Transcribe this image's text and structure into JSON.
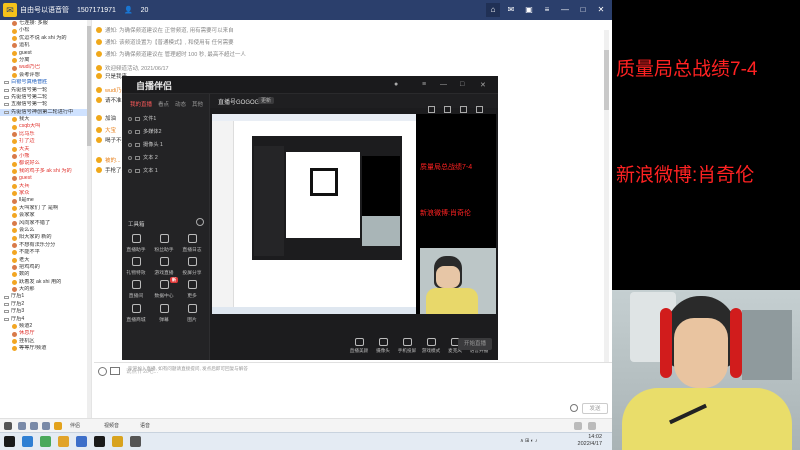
{
  "app": {
    "title": "自由号以语音管",
    "id": "1507171971",
    "count": "20",
    "window_controls": [
      "home",
      "mail",
      "gift",
      "settings",
      "minimize",
      "maximize",
      "close"
    ]
  },
  "sidebar": {
    "items": [
      {
        "label": "七连接: 多服",
        "type": "user"
      },
      {
        "label": "小松",
        "type": "user"
      },
      {
        "label": "优逗不说 ak shi 为的",
        "type": "user"
      },
      {
        "label": "运机",
        "type": "user"
      },
      {
        "label": "guest",
        "type": "user"
      },
      {
        "label": "分离",
        "type": "user"
      },
      {
        "label": "wudi乃巴",
        "type": "red"
      },
      {
        "label": "会考评想",
        "type": "user"
      },
      {
        "label": "白银号真绝普胜",
        "type": "hdr"
      },
      {
        "label": "先驱信号第一轮",
        "type": "channel"
      },
      {
        "label": "先驱信号第二轮",
        "type": "channel"
      },
      {
        "label": "五服信号第一轮",
        "type": "channel"
      },
      {
        "label": "先驱信号神创第二轮进行中",
        "type": "selected"
      },
      {
        "label": "我大",
        "type": "user"
      },
      {
        "label": "csqb大叫",
        "type": "red"
      },
      {
        "label": "比马乐",
        "type": "red"
      },
      {
        "label": "打了边",
        "type": "red"
      },
      {
        "label": "大夫",
        "type": "red"
      },
      {
        "label": "小熊",
        "type": "red"
      },
      {
        "label": "都说好么",
        "type": "red"
      },
      {
        "label": "我的鸡子多 ak shi 为的",
        "type": "red"
      },
      {
        "label": "guest",
        "type": "red"
      },
      {
        "label": "大兵",
        "type": "red"
      },
      {
        "label": "家众",
        "type": "red"
      },
      {
        "label": "ll是me",
        "type": "user"
      },
      {
        "label": "大叫家们 了 是啊",
        "type": "user"
      },
      {
        "label": "会家家",
        "type": "user"
      },
      {
        "label": "风向家不错了",
        "type": "user"
      },
      {
        "label": "会么么",
        "type": "user"
      },
      {
        "label": "阳大家的 新的",
        "type": "user"
      },
      {
        "label": "不想有法乐分分",
        "type": "user"
      },
      {
        "label": "不能不平",
        "type": "user"
      },
      {
        "label": "老大",
        "type": "user"
      },
      {
        "label": "把鸡鸡的",
        "type": "user"
      },
      {
        "label": "数的",
        "type": "user"
      },
      {
        "label": "跃着发 ak shi 用的",
        "type": "user"
      },
      {
        "label": "大的那",
        "type": "user"
      },
      {
        "label": "厅后1",
        "type": "room"
      },
      {
        "label": "厅后2",
        "type": "room"
      },
      {
        "label": "厅后3",
        "type": "room"
      },
      {
        "label": "厅后4",
        "type": "room"
      },
      {
        "label": "频道2",
        "type": "user"
      },
      {
        "label": "休息厅",
        "type": "red"
      },
      {
        "label": "挂机区",
        "type": "user"
      },
      {
        "label": "等等厅/频道",
        "type": "user"
      }
    ]
  },
  "chat": {
    "messages": [
      {
        "text": "通知: 为确保频道建议在 正常频道, 用有需要可以来自",
        "style": "gray"
      },
      {
        "text": "通知: 该频道设置为【普通模式】, 和使用有 任何需要",
        "style": "gray"
      },
      {
        "text": "通知: 为确保频道建议在 管理超时 100 秒, 最高不超过一人",
        "style": "gray"
      },
      {
        "text": "欢迎频道活动, 2021/06/17",
        "style": "gray"
      },
      {
        "text": "只是我来",
        "style": "dark"
      },
      {
        "text": "wudi乃巴",
        "style": "orange"
      },
      {
        "text": "请不准",
        "style": "dark"
      },
      {
        "text": "加油",
        "style": "dark"
      },
      {
        "text": "大宝",
        "style": "orange"
      },
      {
        "text": "喝子不是",
        "style": "dark"
      },
      {
        "text": "被的...",
        "style": "orange"
      },
      {
        "text": "手枪了实",
        "style": "dark"
      }
    ],
    "input_placeholder": "说点什么吧...",
    "send_label": "发送"
  },
  "status_bar": {
    "items": [
      "伴侣",
      "视频音",
      "语音"
    ]
  },
  "obs": {
    "brand": "自播伴侣",
    "tabs": [
      "我的直播",
      "看点",
      "动态",
      "其他"
    ],
    "stream_name": "直播号GOGOGO",
    "stream_tag": "更新",
    "sources": [
      "文件1",
      "多媒体2",
      "摄像头 1",
      "文本 2",
      "文本 1"
    ],
    "tools_title": "工具箱",
    "tools": [
      "直播助手",
      "粉丝助手",
      "直播日志",
      "礼物特效",
      "游戏直播",
      "投屏分享",
      "直播间",
      "数据中心",
      "更多",
      "直播商城",
      "弹幕",
      "图片"
    ],
    "actions": [
      "直播美颜",
      "摄像头",
      "手机投屏",
      "游戏模式",
      "麦克风",
      "语音开播"
    ],
    "live_button": "开始直播",
    "bottom_note": "欢迎加入直播, 如有问题请直接提问, 发点后即可回复与解答"
  },
  "overlay": {
    "line1": "质量局总战绩7-4",
    "line2": "新浪微博:肖奇伦",
    "nested_line1": "质量局总战绩7-4",
    "nested_line2": "新浪微博:肖奇伦"
  },
  "taskbar": {
    "time": "14:02",
    "date": "2022/4/17"
  },
  "colors": {
    "title_bar": "#2b3f6c",
    "overlay_text": "#ff2222",
    "obs_bg": "#1c1c1e"
  }
}
